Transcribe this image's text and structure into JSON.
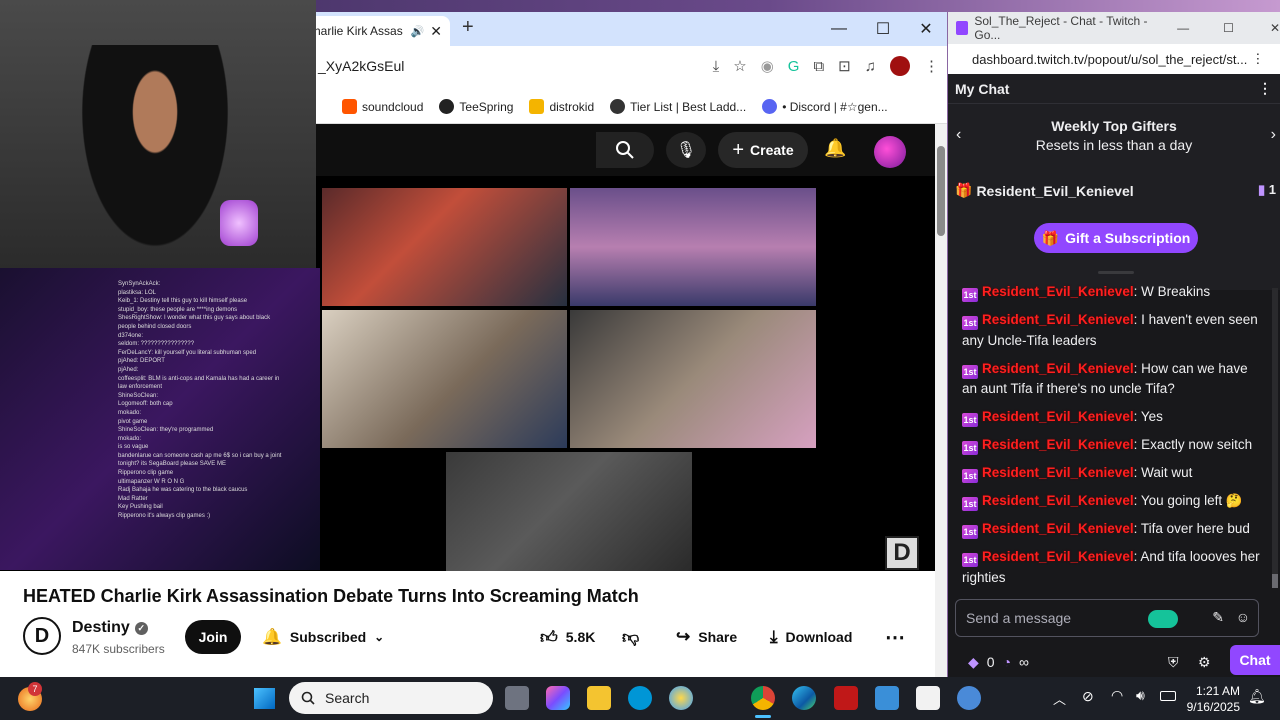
{
  "youtube_browser": {
    "tab_title": "harlie Kirk Assas",
    "url": "_XyA2kGsEul",
    "bookmarks": [
      {
        "label": "soundcloud",
        "color": "#ff5500"
      },
      {
        "label": "TeeSpring",
        "color": "#222222"
      },
      {
        "label": "distrokid",
        "color": "#f4b400"
      },
      {
        "label": "Tier List | Best Ladd...",
        "color": "#333333"
      },
      {
        "label": "• Discord | #☆gen...",
        "color": "#5865f2"
      }
    ],
    "header": {
      "create_label": "Create"
    },
    "video": {
      "title": "HEATED Charlie Kirk Assassination Debate Turns Into Screaming Match",
      "channel_name": "Destiny",
      "channel_initial": "D",
      "subscribers": "847K subscribers",
      "join_label": "Join",
      "subscribed_label": "Subscribed",
      "likes": "5.8K",
      "share_label": "Share",
      "download_label": "Download"
    }
  },
  "overlay_chat_lines": [
    "SynSynAckAck:",
    "plastiksa: LOL",
    "Keib_1: Destiny tell this guy to kill himself please",
    "stupid_boy: these people are ****ing demons",
    "ShesRightShow: I wonder what this guy says about black people behind closed doors",
    "d374one:",
    "seldom: ????????????????",
    "FerDeLancY: kill yourself you literal subhuman sped",
    "pjAhed: DEPORT",
    "pjAhed:",
    "coffeesplit: BLM is anti-cops and Kamala has had a career in law enforcement",
    "ShineSoClean:",
    "Logomeoff: both cap",
    "mokado:",
    "pivot game",
    "ShineSoClean: they're programmed",
    "mokado:",
    "is so vague",
    "bandenlarue can someone cash ap me 6$ so i can buy a joint tonight? its SegaBoard please SAVE ME",
    "Ripperono clip game",
    "ultimapanzer W R O N G",
    "Radj Bahaja he was catering to the black caucus",
    "Mad Ratter",
    "Key Pushing bail",
    "Ripperono it's always clip games :)"
  ],
  "twitch": {
    "window_title": "Sol_The_Reject - Chat - Twitch - Go...",
    "url": "dashboard.twitch.tv/popout/u/sol_the_reject/st...",
    "panel_title": "My Chat",
    "gifters_title": "Weekly Top Gifters",
    "gifters_subtitle": "Resets in less than a day",
    "top_gifter": "Resident_Evil_Kenievel",
    "top_gifter_count": "1",
    "gift_button": "Gift a Subscription",
    "messages": [
      {
        "user": "Resident_Evil_Kenievel",
        "text": "W Breakins"
      },
      {
        "user": "Resident_Evil_Kenievel",
        "text": "I haven't even seen any Uncle-Tifa leaders"
      },
      {
        "user": "Resident_Evil_Kenievel",
        "text": "How can we have an aunt Tifa if there's no uncle Tifa?"
      },
      {
        "user": "Resident_Evil_Kenievel",
        "text": "Yes"
      },
      {
        "user": "Resident_Evil_Kenievel",
        "text": "Exactly now seitch"
      },
      {
        "user": "Resident_Evil_Kenievel",
        "text": "Wait wut"
      },
      {
        "user": "Resident_Evil_Kenievel",
        "text": "You going left 🤔"
      },
      {
        "user": "Resident_Evil_Kenievel",
        "text": "Tifa over here bud"
      },
      {
        "user": "Resident_Evil_Kenievel",
        "text": "And tifa loooves her righties"
      }
    ],
    "input_placeholder": "Send a message",
    "points": "0",
    "infinity": "∞",
    "chat_button": "Chat"
  },
  "taskbar": {
    "notification_count": "7",
    "search_placeholder": "Search",
    "time": "1:21 AM",
    "date": "9/16/2025"
  }
}
